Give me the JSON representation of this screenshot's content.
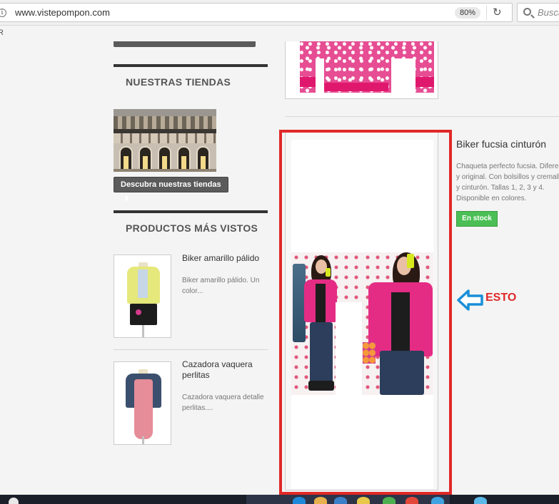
{
  "browser": {
    "url": "www.vistepompon.com",
    "zoom": "80%",
    "search_placeholder": "Buscar",
    "bookmark_stub": "R",
    "info_glyph": "i",
    "reload_glyph": "↻"
  },
  "sidebar": {
    "stores": {
      "title": "NUESTRAS TIENDAS",
      "button_label": "Descubra nuestras tiendas"
    },
    "most_viewed": {
      "title": "PRODUCTOS MÁS VISTOS",
      "items": [
        {
          "name": "Biker amarillo pálido",
          "desc": "Biker amarillo pálido. Un color..."
        },
        {
          "name": "Cazadora vaquera perlitas",
          "desc": "Cazadora vaquera detalle perlitas...."
        }
      ]
    }
  },
  "featured": {
    "title": "Biker fucsia cinturón",
    "description": "Chaqueta perfecto fucsia. Diferente y original. Con bolsillos y cremallera y cinturón. Tallas 1, 2, 3 y 4. Disponible en colores.",
    "stock_label": "En stock"
  },
  "annotation": {
    "label": "ESTO",
    "color": "#e02828",
    "arrow_color": "#1a8fd8"
  },
  "colors": {
    "highlight": "#e02828",
    "stock_green": "#4bbf55"
  }
}
